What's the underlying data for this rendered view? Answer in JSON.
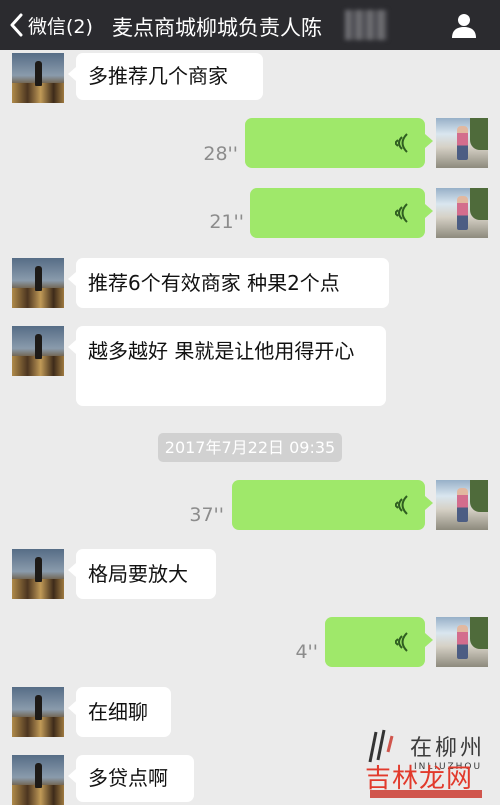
{
  "header": {
    "back_label": "微信(2)",
    "title": "麦点商城柳城负责人陈",
    "back_icon": "chevron-left-icon",
    "profile_icon": "person-icon"
  },
  "messages": [
    {
      "side": "left",
      "type": "text",
      "text": "多推荐几个商家"
    },
    {
      "side": "right",
      "type": "voice",
      "duration": "28''"
    },
    {
      "side": "right",
      "type": "voice",
      "duration": "21''"
    },
    {
      "side": "left",
      "type": "text",
      "text": "推荐6个有效商家 种果2个点"
    },
    {
      "side": "left",
      "type": "text",
      "text": "越多越好 果就是让他用得开心"
    },
    {
      "type": "timestamp",
      "text": "2017年7月22日 09:35"
    },
    {
      "side": "right",
      "type": "voice",
      "duration": "37''"
    },
    {
      "side": "left",
      "type": "text",
      "text": "格局要放大"
    },
    {
      "side": "right",
      "type": "voice",
      "duration": "4''"
    },
    {
      "side": "left",
      "type": "text",
      "text": "在细聊"
    },
    {
      "side": "left",
      "type": "text",
      "text": "多贷点啊"
    }
  ],
  "watermark": {
    "city": "在柳州",
    "pinyin": "INLIUZHOU",
    "brand": "吉林龙网"
  },
  "colors": {
    "header_bg": "#2b2b2f",
    "chat_bg": "#ebebeb",
    "voice_bubble": "#9fe86a",
    "text_bubble": "#ffffff",
    "timestamp_bg": "#d1d1d1",
    "watermark_red": "#e23a2c"
  }
}
